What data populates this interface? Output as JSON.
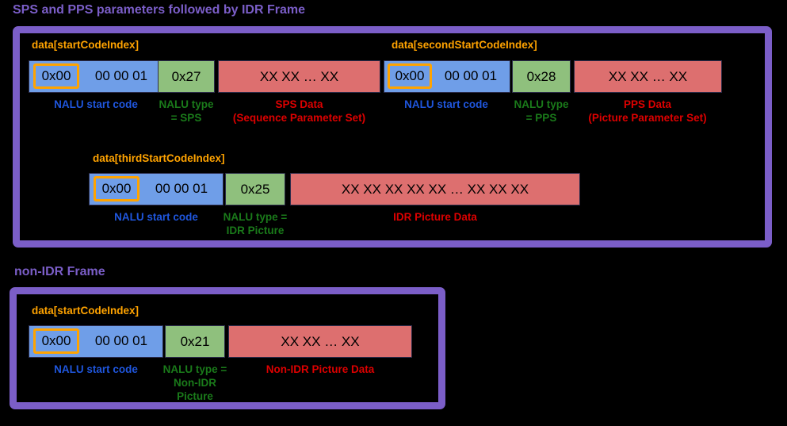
{
  "sections": [
    {
      "title": "SPS and PPS parameters followed by IDR Frame",
      "rows": [
        {
          "index_labels": [
            "data[startCodeIndex]",
            "data[secondStartCodeIndex]"
          ],
          "segments": [
            {
              "start_code_byte": "0x00",
              "start_code_rest": "00  00  01",
              "type_byte": "0x27",
              "payload": "XX  XX  …  XX",
              "caption_start": "NALU start code",
              "caption_type": "NALU type\n= SPS",
              "caption_payload": "SPS Data\n(Sequence Parameter Set)"
            },
            {
              "start_code_byte": "0x00",
              "start_code_rest": "00  00  01",
              "type_byte": "0x28",
              "payload": "XX  XX  …  XX",
              "caption_start": "NALU start code",
              "caption_type": "NALU type\n= PPS",
              "caption_payload": "PPS Data\n(Picture Parameter Set)"
            }
          ]
        },
        {
          "index_labels": [
            "data[thirdStartCodeIndex]"
          ],
          "segments": [
            {
              "start_code_byte": "0x00",
              "start_code_rest": "00  00  01",
              "type_byte": "0x25",
              "payload": "XX  XX  XX  XX  XX  …  XX  XX  XX",
              "caption_start": "NALU start code",
              "caption_type": "NALU type =\nIDR Picture",
              "caption_payload": "IDR Picture Data"
            }
          ]
        }
      ]
    },
    {
      "title": "non-IDR Frame",
      "rows": [
        {
          "index_labels": [
            "data[startCodeIndex]"
          ],
          "segments": [
            {
              "start_code_byte": "0x00",
              "start_code_rest": "00  00  01",
              "type_byte": "0x21",
              "payload": "XX  XX    …   XX",
              "caption_start": "NALU start code",
              "caption_type": "NALU type =\nNon-IDR\nPicture",
              "caption_payload": "Non-IDR Picture Data"
            }
          ]
        }
      ]
    }
  ],
  "colors": {
    "background": "#000000",
    "frame_purple": "#7b5ec8",
    "index_orange": "#ffa300",
    "nalu_blue_fill": "#6f9ee8",
    "nalu_green_fill": "#8fc07d",
    "nalu_red_fill": "#dd6f6f",
    "caption_blue": "#1f56dd",
    "caption_green": "#1a7a1a",
    "caption_red": "#dd0000"
  }
}
